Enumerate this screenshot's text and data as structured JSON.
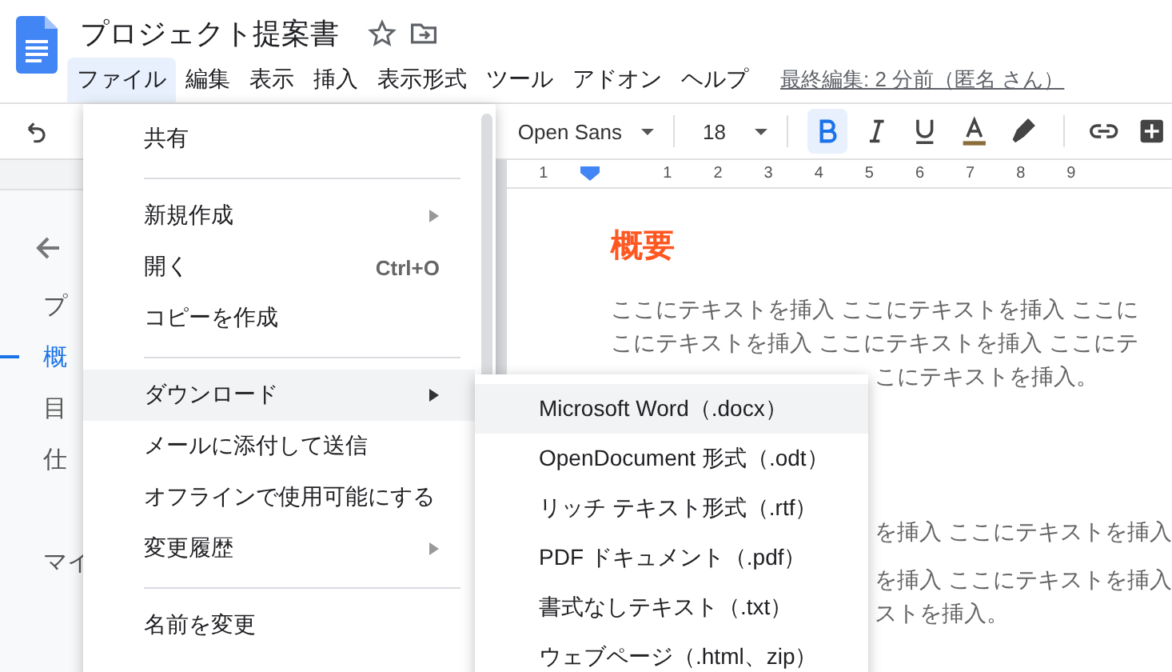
{
  "app": {
    "title": "プロジェクト提案書",
    "last_edit": "最終編集: 2 分前（匿名 さん）",
    "menus": [
      {
        "label": "ファイル",
        "selected": true
      },
      {
        "label": "編集",
        "selected": false
      },
      {
        "label": "表示",
        "selected": false
      },
      {
        "label": "挿入",
        "selected": false
      },
      {
        "label": "表示形式",
        "selected": false
      },
      {
        "label": "ツール",
        "selected": false
      },
      {
        "label": "アドオン",
        "selected": false
      },
      {
        "label": "ヘルプ",
        "selected": false
      }
    ]
  },
  "toolbar": {
    "font": "Open Sans",
    "size": "18",
    "bold": true
  },
  "ruler": {
    "ticks": [
      "1",
      "1",
      "2",
      "3",
      "4",
      "5",
      "6",
      "7",
      "8",
      "9"
    ]
  },
  "outline": {
    "items": [
      {
        "label": "プ",
        "selected": false
      },
      {
        "label": "概",
        "selected": true
      },
      {
        "label": "目",
        "selected": false
      },
      {
        "label": "仕",
        "selected": false
      },
      {
        "label": "マイ",
        "selected": false
      }
    ]
  },
  "document": {
    "heading": "概要",
    "lines": [
      {
        "kind": "full",
        "text": "ここにテキストを挿入 ここにテキストを挿入 ここに"
      },
      {
        "kind": "full",
        "text": "こにテキストを挿入 ここにテキストを挿入 ここにテ"
      },
      {
        "kind": "fragment",
        "text": "こにテキストを挿入。"
      },
      {
        "kind": "gap"
      },
      {
        "kind": "fragment",
        "text": "を挿入 ここにテキストを挿入"
      },
      {
        "kind": "gap"
      },
      {
        "kind": "fragment",
        "text": "を挿入 ここにテキストを挿入"
      },
      {
        "kind": "fragment",
        "text": "ストを挿入。"
      }
    ]
  },
  "file_menu": {
    "items": [
      {
        "kind": "item",
        "label": "共有",
        "selected": false
      },
      {
        "kind": "divider"
      },
      {
        "kind": "item",
        "label": "新規作成",
        "submenu": true,
        "selected": false
      },
      {
        "kind": "item",
        "label": "開く",
        "shortcut": "Ctrl+O",
        "selected": false
      },
      {
        "kind": "item",
        "label": "コピーを作成",
        "selected": false
      },
      {
        "kind": "divider"
      },
      {
        "kind": "item",
        "label": "ダウンロード",
        "submenu": true,
        "selected": true
      },
      {
        "kind": "item",
        "label": "メールに添付して送信",
        "selected": false
      },
      {
        "kind": "item",
        "label": "オフラインで使用可能にする",
        "selected": false
      },
      {
        "kind": "item",
        "label": "変更履歴",
        "submenu": true,
        "selected": false
      },
      {
        "kind": "divider"
      },
      {
        "kind": "item",
        "label": "名前を変更",
        "selected": false
      }
    ]
  },
  "download_menu": {
    "items": [
      {
        "label": "Microsoft Word（.docx）",
        "selected": true
      },
      {
        "label": "OpenDocument 形式（.odt）",
        "selected": false
      },
      {
        "label": "リッチ テキスト形式（.rtf）",
        "selected": false
      },
      {
        "label": "PDF ドキュメント（.pdf）",
        "selected": false
      },
      {
        "label": "書式なしテキスト（.txt）",
        "selected": false
      },
      {
        "label": "ウェブページ（.html、zip）",
        "selected": false
      }
    ]
  }
}
